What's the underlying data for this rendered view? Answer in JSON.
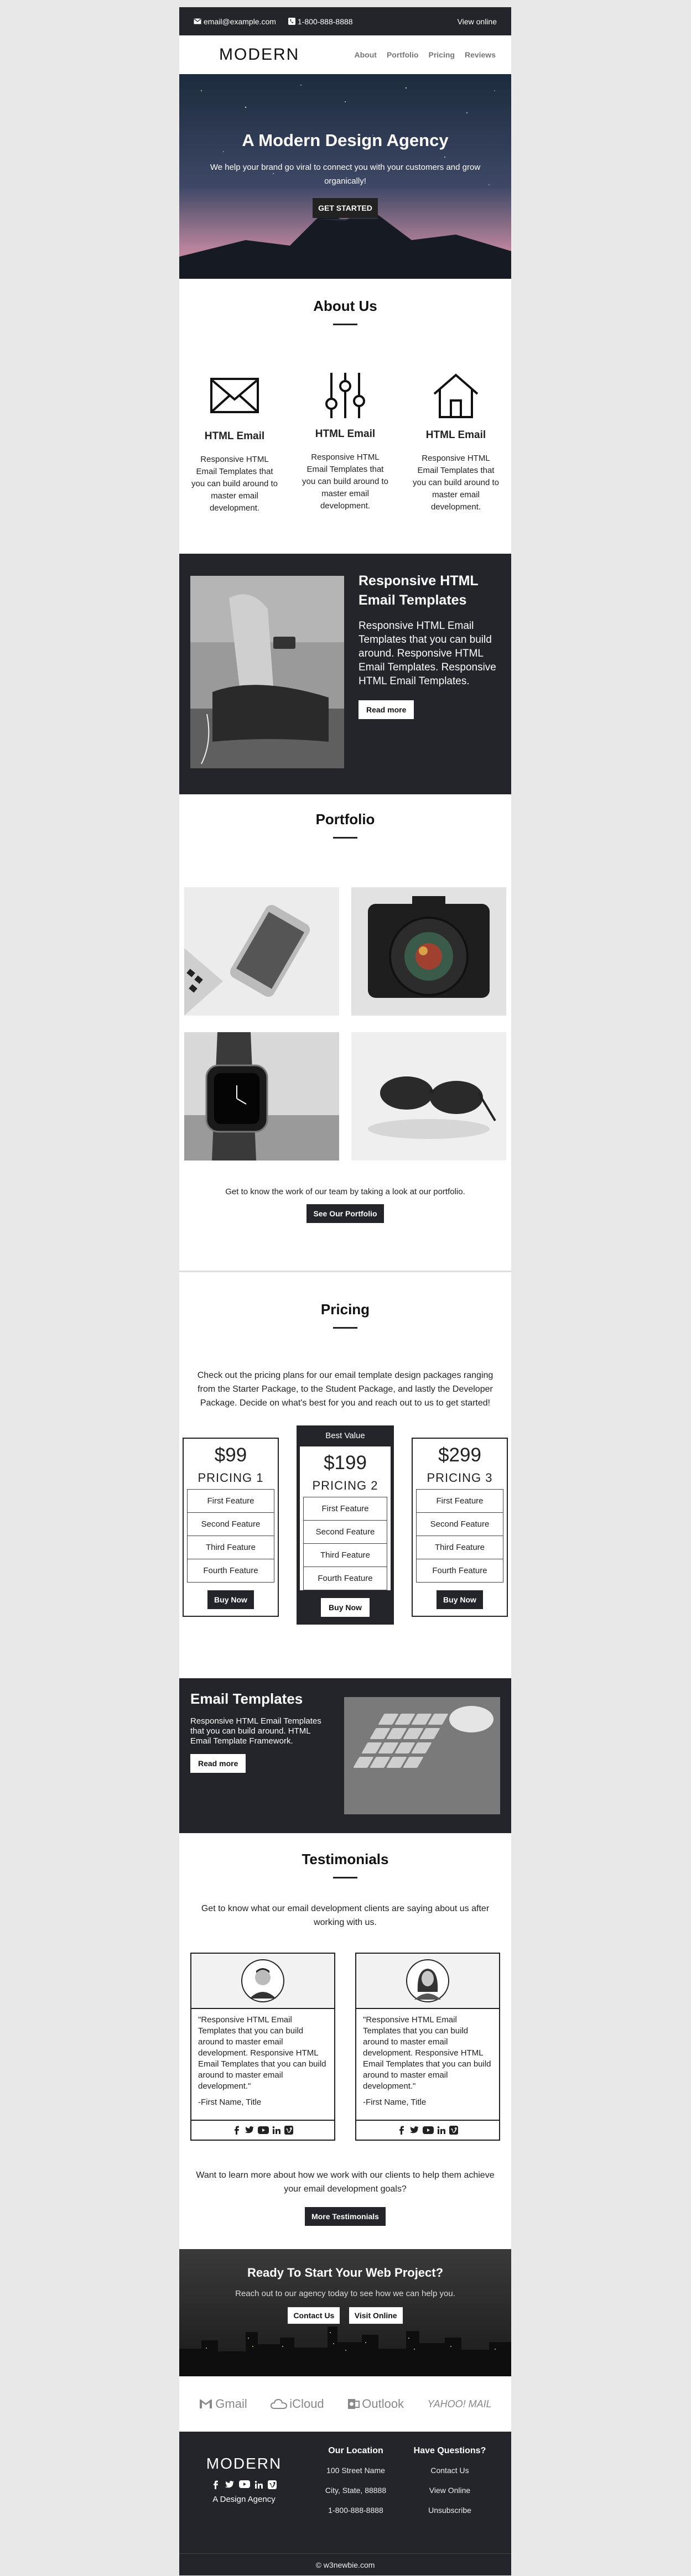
{
  "topbar": {
    "email": "email@example.com",
    "phone": "1-800-888-8888",
    "view_online": "View online"
  },
  "header": {
    "logo": "MODERN",
    "nav": [
      "About",
      "Portfolio",
      "Pricing",
      "Reviews"
    ]
  },
  "hero": {
    "title": "A Modern Design Agency",
    "text": "We help your brand go viral to connect you with your customers and grow organically!",
    "button": "GET STARTED"
  },
  "about": {
    "title": "About Us",
    "columns": [
      {
        "icon": "mail-icon",
        "heading": "HTML Email",
        "text": "Responsive HTML Email Templates that you can build around to master email development."
      },
      {
        "icon": "sliders-icon",
        "heading": "HTML Email",
        "text": "Responsive HTML Email Templates that you can build around to master email development."
      },
      {
        "icon": "home-icon",
        "heading": "HTML Email",
        "text": "Responsive HTML Email Templates that you can build around to master email development."
      }
    ]
  },
  "feature": {
    "title": "Responsive HTML Email Templates",
    "text": "Responsive HTML Email Templates that you can build around. Responsive HTML Email Templates. Responsive HTML Email Templates.",
    "button": "Read more"
  },
  "portfolio": {
    "title": "Portfolio",
    "text": "Get to know the work of our team by taking a look at our portfolio.",
    "button": "See Our Portfolio"
  },
  "pricing": {
    "title": "Pricing",
    "intro": "Check out the pricing plans for our email template design packages ranging from the Starter Package, to the Student Package, and lastly the Developer Package. Decide on what's best for you and reach out to us to get started!",
    "plans": [
      {
        "price": "$99",
        "name": "PRICING 1",
        "features": [
          "First Feature",
          "Second Feature",
          "Third Feature",
          "Fourth Feature"
        ],
        "button": "Buy Now"
      },
      {
        "badge": "Best Value",
        "price": "$199",
        "name": "PRICING 2",
        "features": [
          "First Feature",
          "Second Feature",
          "Third Feature",
          "Fourth Feature"
        ],
        "button": "Buy Now"
      },
      {
        "price": "$299",
        "name": "PRICING 3",
        "features": [
          "First Feature",
          "Second Feature",
          "Third Feature",
          "Fourth Feature"
        ],
        "button": "Buy Now"
      }
    ]
  },
  "email_templates": {
    "title": "Email Templates",
    "text": "Responsive HTML Email Templates that you can build around. HTML Email Template Framework.",
    "button": "Read more"
  },
  "testimonials": {
    "title": "Testimonials",
    "intro": "Get to know what our email development clients are saying about us after working with us.",
    "cards": [
      {
        "quote": "\"Responsive HTML Email Templates that you can build around to master email development. Responsive HTML Email Templates that you can build around to master email development.\"",
        "author": "-First Name, Title"
      },
      {
        "quote": "\"Responsive HTML Email Templates that you can build around to master email development. Responsive HTML Email Templates that you can build around to master email development.\"",
        "author": "-First Name, Title"
      }
    ],
    "more_text": "Want to learn more about how we work with our clients to help them achieve your email development goals?",
    "button": "More Testimonials"
  },
  "cta": {
    "title": "Ready To Start Your Web Project?",
    "text": "Reach out to our agency today to see how we can help you.",
    "contact_button": "Contact Us",
    "visit_button": "Visit Online"
  },
  "clients": [
    "Gmail",
    "iCloud",
    "Outlook",
    "YAHOO! MAIL"
  ],
  "footer": {
    "logo": "MODERN",
    "tagline": "A Design Agency",
    "location_title": "Our Location",
    "location": [
      "100 Street Name",
      "City, State, 88888",
      "1-800-888-8888"
    ],
    "questions_title": "Have Questions?",
    "links": [
      "Contact Us",
      "View Online",
      "Unsubscribe"
    ],
    "copyright": "© w3newbie.com"
  },
  "colors": {
    "dark": "#23252a",
    "page_bg": "#e8e8e8",
    "white": "#ffffff"
  }
}
